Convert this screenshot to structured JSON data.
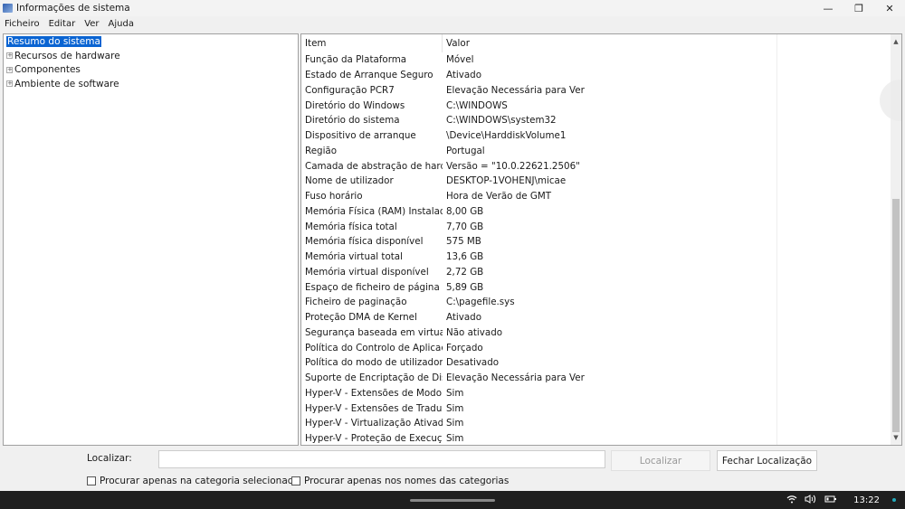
{
  "window": {
    "title": "Informações de sistema",
    "minimize": "—",
    "maximize": "❐",
    "close": "✕"
  },
  "menu": [
    "Ficheiro",
    "Editar",
    "Ver",
    "Ajuda"
  ],
  "tree": {
    "selected": "Resumo do sistema",
    "children": [
      "Recursos de hardware",
      "Componentes",
      "Ambiente de software"
    ]
  },
  "list": {
    "headers": [
      "Item",
      "Valor"
    ],
    "rows": [
      [
        "Função da Plataforma",
        "Móvel"
      ],
      [
        "Estado de Arranque Seguro",
        "Ativado"
      ],
      [
        "Configuração PCR7",
        "Elevação Necessária para Ver"
      ],
      [
        "Diretório do Windows",
        "C:\\WINDOWS"
      ],
      [
        "Diretório do sistema",
        "C:\\WINDOWS\\system32"
      ],
      [
        "Dispositivo de arranque",
        "\\Device\\HarddiskVolume1"
      ],
      [
        "Região",
        "Portugal"
      ],
      [
        "Camada de abstração de hardw...",
        "Versão = \"10.0.22621.2506\""
      ],
      [
        "Nome de utilizador",
        "DESKTOP-1VOHENJ\\micae"
      ],
      [
        "Fuso horário",
        "Hora de Verão de GMT"
      ],
      [
        "Memória Física (RAM) Instalada",
        "8,00 GB"
      ],
      [
        "Memória física total",
        "7,70 GB"
      ],
      [
        "Memória física disponível",
        "575 MB"
      ],
      [
        "Memória virtual total",
        "13,6 GB"
      ],
      [
        "Memória virtual disponível",
        "2,72 GB"
      ],
      [
        "Espaço de ficheiro de página",
        "5,89 GB"
      ],
      [
        "Ficheiro de paginação",
        "C:\\pagefile.sys"
      ],
      [
        "Proteção DMA de Kernel",
        "Ativado"
      ],
      [
        "Segurança baseada em virtualiz...",
        "Não ativado"
      ],
      [
        "Política do Controlo de Aplicaç...",
        "Forçado"
      ],
      [
        "Política do modo de utilizador ...",
        "Desativado"
      ],
      [
        "Suporte de Encriptação de Disp...",
        "Elevação Necessária para Ver"
      ],
      [
        "Hyper-V - Extensões de Modo d...",
        "Sim"
      ],
      [
        "Hyper-V - Extensões de Traduçã...",
        "Sim"
      ],
      [
        "Hyper-V - Virtualização Ativada ...",
        "Sim"
      ],
      [
        "Hyper-V - Proteção de Execuçã...",
        "Sim"
      ]
    ],
    "scroll_position_percent": 55
  },
  "find": {
    "label": "Localizar:",
    "value": "",
    "find_button": "Localizar",
    "close_button": "Fechar Localização",
    "check1": "Procurar apenas na categoria selecionada",
    "check2": "Procurar apenas nos nomes das categorias"
  },
  "taskbar": {
    "time": "13:22",
    "wifi": "wifi-icon",
    "volume": "volume-icon",
    "battery": "battery-icon"
  }
}
